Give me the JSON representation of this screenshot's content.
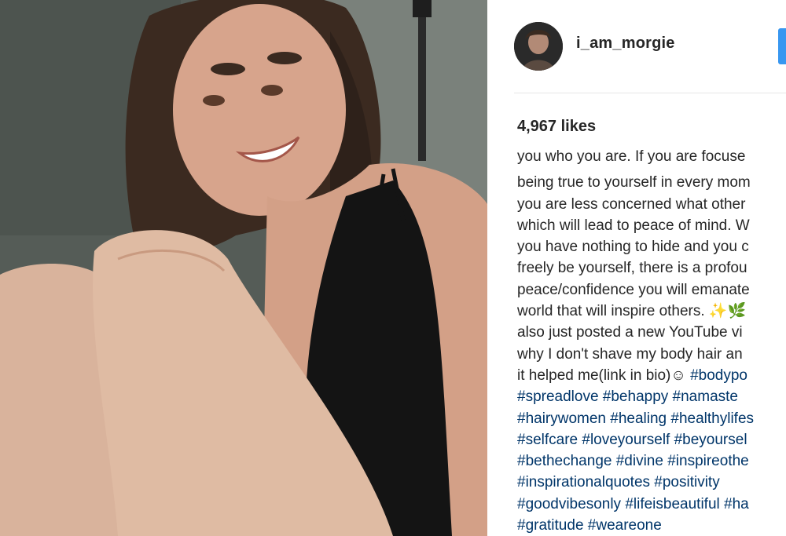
{
  "post": {
    "username": "i_am_morgie",
    "likes": "4,967 likes",
    "caption_lines": [
      "you who you are. If you are focuse",
      "being true to yourself in every mom",
      "you are less concerned what other",
      "which will lead to peace of mind. W",
      "you have nothing to hide and you c",
      "freely be yourself, there is a profou",
      "peace/confidence you will emanate",
      "world that will inspire others. ✨🌿",
      "also just posted a new YouTube vi",
      "why I don't shave my body hair an",
      "it helped me(link in bio)☺"
    ],
    "inline_tag": "#bodypo",
    "hashtag_lines": [
      "#spreadlove #behappy #namaste",
      "#hairywomen #healing #healthylifes",
      "#selfcare #loveyourself #beyoursel",
      "#bethechange #divine #inspireothe",
      "#inspirationalquotes #positivity",
      "#goodvibesonly #lifeisbeautiful #ha",
      "#gratitude #weareone"
    ]
  },
  "colors": {
    "text": "#262626",
    "hashtag": "#003569",
    "follow_button": "#3897f0",
    "divider": "#e6e6e6"
  },
  "icons": {
    "avatar": "profile-photo",
    "follow": "follow-button"
  }
}
